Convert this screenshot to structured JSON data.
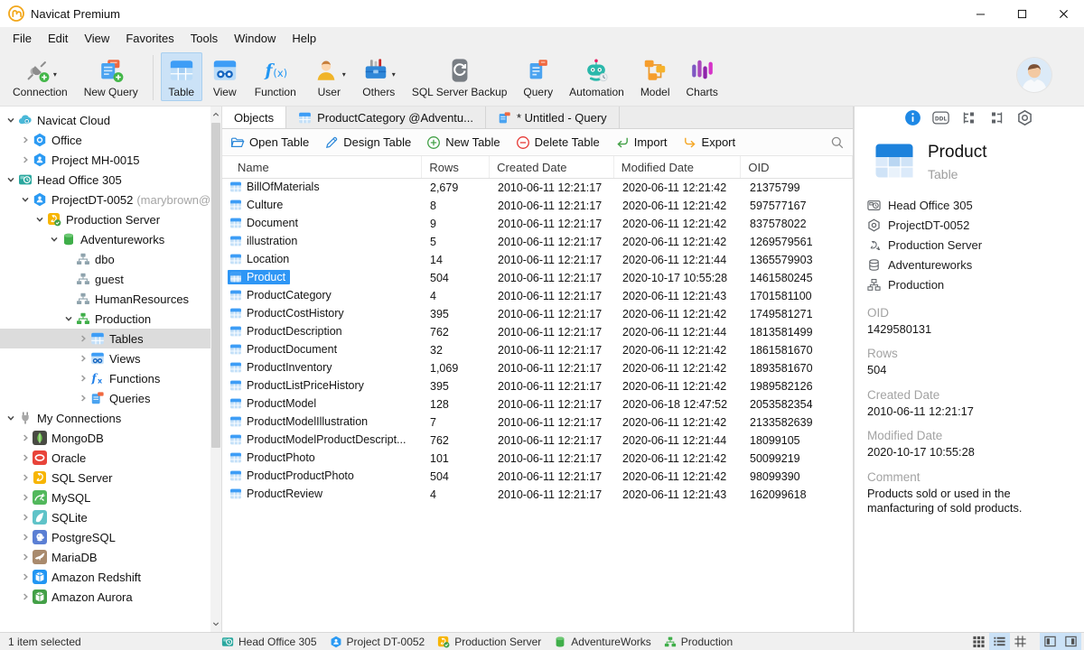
{
  "window": {
    "title": "Navicat Premium"
  },
  "menu": [
    "File",
    "Edit",
    "View",
    "Favorites",
    "Tools",
    "Window",
    "Help"
  ],
  "toolbar": [
    {
      "label": "Connection",
      "icon": "conn-big",
      "dropdown": true
    },
    {
      "label": "New Query",
      "icon": "newquery-big"
    },
    {
      "sep": true
    },
    {
      "label": "Table",
      "icon": "table-big",
      "active": true
    },
    {
      "label": "View",
      "icon": "view-big"
    },
    {
      "label": "Function",
      "icon": "fx-big"
    },
    {
      "label": "User",
      "icon": "user-big",
      "dropdown": true
    },
    {
      "label": "Others",
      "icon": "others-big",
      "dropdown": true
    },
    {
      "label": "SQL Server Backup",
      "icon": "backup-big"
    },
    {
      "label": "Query",
      "icon": "query-big"
    },
    {
      "label": "Automation",
      "icon": "auto-big"
    },
    {
      "label": "Model",
      "icon": "model-big"
    },
    {
      "label": "Charts",
      "icon": "charts-big"
    }
  ],
  "sidebar": {
    "items": [
      {
        "label": "Navicat Cloud",
        "depth": 0,
        "arrow": "down",
        "icon": "cloud"
      },
      {
        "label": "Office",
        "depth": 1,
        "arrow": "right",
        "icon": "office"
      },
      {
        "label": "Project MH-0015",
        "depth": 1,
        "arrow": "right",
        "icon": "project"
      },
      {
        "label": "Head Office 305",
        "depth": 0,
        "arrow": "down",
        "icon": "headoffice"
      },
      {
        "label": "ProjectDT-0052",
        "suffix": "(marybrown@",
        "depth": 1,
        "arrow": "down",
        "icon": "project"
      },
      {
        "label": "Production Server",
        "depth": 2,
        "arrow": "down",
        "icon": "server-check"
      },
      {
        "label": "Adventureworks",
        "depth": 3,
        "arrow": "down",
        "icon": "db-green"
      },
      {
        "label": "dbo",
        "depth": 4,
        "arrow": "",
        "icon": "schema-gray"
      },
      {
        "label": "guest",
        "depth": 4,
        "arrow": "",
        "icon": "schema-gray"
      },
      {
        "label": "HumanResources",
        "depth": 4,
        "arrow": "",
        "icon": "schema-gray"
      },
      {
        "label": "Production",
        "depth": 4,
        "arrow": "down",
        "icon": "schema-green"
      },
      {
        "label": "Tables",
        "depth": 5,
        "arrow": "right",
        "icon": "tbl",
        "selected": true
      },
      {
        "label": "Views",
        "depth": 5,
        "arrow": "right",
        "icon": "view16"
      },
      {
        "label": "Functions",
        "depth": 5,
        "arrow": "right",
        "icon": "fx16"
      },
      {
        "label": "Queries",
        "depth": 5,
        "arrow": "right",
        "icon": "query16"
      },
      {
        "label": "My Connections",
        "depth": 0,
        "arrow": "down",
        "icon": "plug"
      },
      {
        "label": "MongoDB",
        "depth": 1,
        "arrow": "right",
        "icon": "mongodb"
      },
      {
        "label": "Oracle",
        "depth": 1,
        "arrow": "right",
        "icon": "oracle"
      },
      {
        "label": "SQL Server",
        "depth": 1,
        "arrow": "right",
        "icon": "server-plain"
      },
      {
        "label": "MySQL",
        "depth": 1,
        "arrow": "right",
        "icon": "mysql"
      },
      {
        "label": "SQLite",
        "depth": 1,
        "arrow": "right",
        "icon": "sqlite"
      },
      {
        "label": "PostgreSQL",
        "depth": 1,
        "arrow": "right",
        "icon": "postgres"
      },
      {
        "label": "MariaDB",
        "depth": 1,
        "arrow": "right",
        "icon": "mariadb"
      },
      {
        "label": "Amazon Redshift",
        "depth": 1,
        "arrow": "right",
        "icon": "redshift"
      },
      {
        "label": "Amazon Aurora",
        "depth": 1,
        "arrow": "right",
        "icon": "aurora"
      }
    ]
  },
  "tabs": [
    {
      "label": "Objects",
      "active": true
    },
    {
      "label": "ProductCategory @Adventu...",
      "icon": "tbl"
    },
    {
      "label": "* Untitled - Query",
      "icon": "query16"
    }
  ],
  "object_toolbar": {
    "buttons": [
      {
        "label": "Open Table",
        "icon": "folder"
      },
      {
        "label": "Design Table",
        "icon": "pencil"
      },
      {
        "label": "New Table",
        "icon": "plus"
      },
      {
        "label": "Delete Table",
        "icon": "minus"
      },
      {
        "label": "Import",
        "icon": "import"
      },
      {
        "label": "Export",
        "icon": "export"
      }
    ]
  },
  "grid": {
    "columns": [
      "Name",
      "Rows",
      "Created Date",
      "Modified Date",
      "OID"
    ],
    "rows": [
      {
        "name": "BillOfMaterials",
        "rows": "2,679",
        "created": "2010-06-11 12:21:17",
        "modified": "2020-06-11 12:21:42",
        "oid": "21375799"
      },
      {
        "name": "Culture",
        "rows": "8",
        "created": "2010-06-11 12:21:17",
        "modified": "2020-06-11 12:21:42",
        "oid": "597577167"
      },
      {
        "name": "Document",
        "rows": "9",
        "created": "2010-06-11 12:21:17",
        "modified": "2020-06-11 12:21:42",
        "oid": "837578022"
      },
      {
        "name": "illustration",
        "rows": "5",
        "created": "2010-06-11 12:21:17",
        "modified": "2020-06-11 12:21:42",
        "oid": "1269579561"
      },
      {
        "name": "Location",
        "rows": "14",
        "created": "2010-06-11 12:21:17",
        "modified": "2020-06-11 12:21:44",
        "oid": "1365579903"
      },
      {
        "name": "Product",
        "rows": "504",
        "created": "2010-06-11 12:21:17",
        "modified": "2020-10-17 10:55:28",
        "oid": "1461580245",
        "selected": true
      },
      {
        "name": "ProductCategory",
        "rows": "4",
        "created": "2010-06-11 12:21:17",
        "modified": "2020-06-11 12:21:43",
        "oid": "1701581100"
      },
      {
        "name": "ProductCostHistory",
        "rows": "395",
        "created": "2010-06-11 12:21:17",
        "modified": "2020-06-11 12:21:42",
        "oid": "1749581271"
      },
      {
        "name": "ProductDescription",
        "rows": "762",
        "created": "2010-06-11 12:21:17",
        "modified": "2020-06-11 12:21:44",
        "oid": "1813581499"
      },
      {
        "name": "ProductDocument",
        "rows": "32",
        "created": "2010-06-11 12:21:17",
        "modified": "2020-06-11 12:21:42",
        "oid": "1861581670"
      },
      {
        "name": "ProductInventory",
        "rows": "1,069",
        "created": "2010-06-11 12:21:17",
        "modified": "2020-06-11 12:21:42",
        "oid": "1893581670"
      },
      {
        "name": "ProductListPriceHistory",
        "rows": "395",
        "created": "2010-06-11 12:21:17",
        "modified": "2020-06-11 12:21:42",
        "oid": "1989582126"
      },
      {
        "name": "ProductModel",
        "rows": "128",
        "created": "2010-06-11 12:21:17",
        "modified": "2020-06-18 12:47:52",
        "oid": "2053582354"
      },
      {
        "name": "ProductModelIllustration",
        "rows": "7",
        "created": "2010-06-11 12:21:17",
        "modified": "2020-06-11 12:21:42",
        "oid": "2133582639"
      },
      {
        "name": "ProductModelProductDescript...",
        "rows": "762",
        "created": "2010-06-11 12:21:17",
        "modified": "2020-06-11 12:21:44",
        "oid": "18099105"
      },
      {
        "name": "ProductPhoto",
        "rows": "101",
        "created": "2010-06-11 12:21:17",
        "modified": "2020-06-11 12:21:42",
        "oid": "50099219"
      },
      {
        "name": "ProductProductPhoto",
        "rows": "504",
        "created": "2010-06-11 12:21:17",
        "modified": "2020-06-11 12:21:42",
        "oid": "98099390"
      },
      {
        "name": "ProductReview",
        "rows": "4",
        "created": "2010-06-11 12:21:17",
        "modified": "2020-06-11 12:21:43",
        "oid": "162099618"
      }
    ]
  },
  "detail": {
    "tabs": [
      {
        "name": "info-tab-icon",
        "icon": "info-f",
        "active": true
      },
      {
        "name": "ddl-tab-icon",
        "icon": "ddl"
      },
      {
        "name": "used-by-tab-icon",
        "icon": "struct1"
      },
      {
        "name": "uses-tab-icon",
        "icon": "struct2"
      },
      {
        "name": "options-tab-icon",
        "icon": "nut"
      }
    ],
    "title": "Product",
    "subtitle": "Table",
    "location": [
      {
        "label": "Head Office 305",
        "icon": "ho-gray"
      },
      {
        "label": "ProjectDT-0052",
        "icon": "hex-gray"
      },
      {
        "label": "Production Server",
        "icon": "srv-gray"
      },
      {
        "label": "Adventureworks",
        "icon": "db-gray"
      },
      {
        "label": "Production",
        "icon": "schema-gray-o"
      }
    ],
    "fields": [
      {
        "label": "OID",
        "value": "1429580131"
      },
      {
        "label": "Rows",
        "value": "504"
      },
      {
        "label": "Created Date",
        "value": "2010-06-11 12:21:17"
      },
      {
        "label": "Modified Date",
        "value": "2020-10-17 10:55:28"
      },
      {
        "label": "Comment",
        "value": "Products sold or used in the manfacturing of sold products."
      }
    ]
  },
  "statusbar": {
    "left": "1 item selected",
    "breadcrumbs": [
      {
        "label": "Head Office 305",
        "icon": "headoffice"
      },
      {
        "label": "Project DT-0052",
        "icon": "project"
      },
      {
        "label": "Production Server",
        "icon": "server-check"
      },
      {
        "label": "AdventureWorks",
        "icon": "db-green"
      },
      {
        "label": "Production",
        "icon": "schema-green"
      }
    ],
    "view_buttons": [
      {
        "name": "grid-view-icon",
        "icon": "grid9"
      },
      {
        "name": "list-view-icon",
        "icon": "listlines",
        "active": true
      },
      {
        "name": "detail-view-icon",
        "icon": "gridlines"
      },
      {
        "name": "left-panel-toggle-icon",
        "icon": "panelL",
        "active": true,
        "gap": true
      },
      {
        "name": "right-panel-toggle-icon",
        "icon": "panelR",
        "active": true
      }
    ]
  },
  "colors": {
    "accent_blue": "#2e96f5",
    "toolbar_active": "#cbe2f7",
    "tree_selected": "#dcdcdc",
    "status_green": "#43a047"
  }
}
